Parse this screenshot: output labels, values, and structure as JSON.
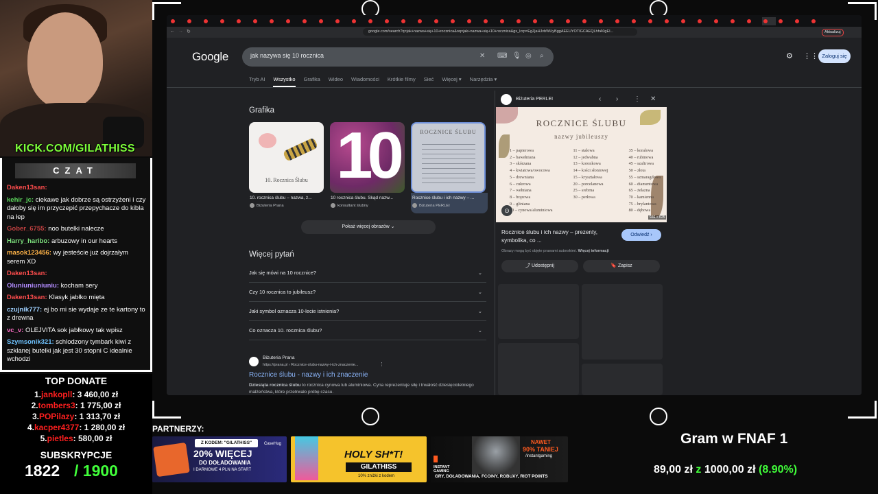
{
  "stream": {
    "channel": "KICK.COM/GILATHISS",
    "chat_header": "CZAT",
    "chat": [
      {
        "user": "Daken13san:",
        "text": "",
        "color": "#ff4d4d"
      },
      {
        "user": "kehir_jc:",
        "text": "ciekawe jak dobrze są ostrzyżeni i czy dałoby się im przyczepić przepychacze do kibla na łep",
        "color": "#5dd55d"
      },
      {
        "user": "Gober_6755:",
        "text": "noo butelki nalecze",
        "color": "#c04040"
      },
      {
        "user": "Harry_haribo:",
        "text": "arbuzowy in our hearts",
        "color": "#7de07d"
      },
      {
        "user": "masok123456:",
        "text": "wy jesteście już dojrzałym serem XD",
        "color": "#ffb347"
      },
      {
        "user": "Daken13san:",
        "text": "",
        "color": "#ff4d4d"
      },
      {
        "user": "Oluniuniuniuniu:",
        "text": "kocham sery",
        "color": "#b38cff"
      },
      {
        "user": "Daken13san:",
        "text": "Klasyk jabłko mięta",
        "color": "#ff4d4d"
      },
      {
        "user": "czujnik777:",
        "text": "ej bo mi sie wydaje ze te kartony to z drewna",
        "color": "#9fd0ff"
      },
      {
        "user": "vc_v:",
        "text": "OLEJVITA sok jabłkowy tak wpisz",
        "color": "#ff6ec7"
      },
      {
        "user": "Szymsonik321:",
        "text": "schlodzony tymbark kiwi z szklanej butelki jak jest 30 stopni C idealnie wchodzi",
        "color": "#6fc3ff"
      }
    ],
    "top_donate_title": "TOP DONATE",
    "donors": [
      {
        "rank": "1.",
        "name": "jankopll",
        "amount": ": 3 460,00 zł"
      },
      {
        "rank": "2.",
        "name": "tombers3",
        "amount": ": 1 775,00 zł"
      },
      {
        "rank": "3.",
        "name": "POPilazy",
        "amount": ": 1 313,70 zł"
      },
      {
        "rank": "4.",
        "name": "kacper4377",
        "amount": ": 1 280,00 zł"
      },
      {
        "rank": "5.",
        "name": "pietles",
        "amount": ": 580,00 zł"
      }
    ],
    "subs_title": "SUBSKRYPCJE",
    "subs_current": "1822",
    "subs_goal": "/ 1900",
    "partners_label": "PARTNERZY:",
    "banner1": {
      "code": "Z KODEM: \"GILATHISS\"",
      "big": "20% WIĘCEJ",
      "mid": "DO DOŁADOWANIA",
      "small": "I DARMOWE 4 PLN NA START",
      "brand": "CaseHug"
    },
    "banner2": {
      "big": "HOLY SH*T!",
      "mid": "GILATHISS",
      "small": "10% zniżki z kodem"
    },
    "banner3": {
      "tag": "NAWET",
      "big": "90% TANIEJ",
      "handle": "/instantgaming",
      "brand": "INSTANT GAMING",
      "small": "GRY, DOŁADOWANIA, FCOINY, ROBUXY, RIOT POINTS"
    },
    "game_title": "Gram w FNAF 1",
    "goal_current": "89,00 zł",
    "goal_sep": "z",
    "goal_total": "1000,00 zł",
    "goal_pct": "(8.90%)"
  },
  "browser": {
    "url": "google.com/search?q=jak+nazwa+się+10+rocznica&oq=jak+nazwa+się+10+rocznica&gs_lcrp=EgZjaHJvbWUyBggAEEUYOTIGCAEQLhhA0gEI...",
    "update_label": "Aktualizuj",
    "google_logo": "Google",
    "query": "jak nazywa się 10 rocznica",
    "signin": "Zaloguj się",
    "nav": [
      "Tryb AI",
      "Wszystko",
      "Grafika",
      "Wideo",
      "Wiadomości",
      "Krótkie filmy",
      "Sieć",
      "Więcej ▾",
      "Narzędzia ▾"
    ],
    "images_heading": "Grafika",
    "images": [
      {
        "caption": "10. rocznica ślubu – nazwa, ż...",
        "source": "Biżuteria Prana",
        "overlay": "10. Rocznica Ślubu"
      },
      {
        "caption": "10 rocznica ślubu. Skąd nazw...",
        "source": "konsultant ślubny",
        "overlay": "10"
      },
      {
        "caption": "Rocznice ślubu i ich nazwy – ...",
        "source": "Biżuteria PERLEI",
        "overlay": "ROCZNICE ŚLUBU"
      }
    ],
    "more_images": "Pokaż więcej obrazów ⌄",
    "paa_heading": "Więcej pytań",
    "questions": [
      "Jak się mówi na 10 rocznice?",
      "Czy 10 rocznica to jubileusz?",
      "Jaki symbol oznacza 10-lecie istnienia?",
      "Co oznacza 10. rocznica ślubu?"
    ],
    "result": {
      "source": "Biżuteria Prana",
      "url": "https://prana.pl › Rocznice-slubu-nazwy-i-ich-znaczenie...",
      "title": "Rocznice ślubu - nazwy i ich znaczenie",
      "snippet_bold": "Dziesiąta rocznica ślubu",
      "snippet": " to rocznica cynowa lub aluminiowa. Cyna reprezentuje siłę i trwałość dziesięcioletniego małżeństwa, które przetrwało próbę czasu."
    },
    "panel": {
      "source": "Biżuteria PERLEI",
      "img_title": "ROCZNICE ŚLUBU",
      "img_subtitle": "nazwy jubileuszy",
      "col1": [
        "1 – papierowa",
        "2 – bawełniana",
        "3 – skórzana",
        "4 – kwiatowa/owocowa",
        "5 – drewniana",
        "6 – cukrowa",
        "7 – wełniana",
        "8 – brązowa",
        "9 – gliniana",
        "10 – cynowa/aluminiowa"
      ],
      "col2": [
        "11 – stalowa",
        "12 – jedwabna",
        "13 – koronkowa",
        "14 – kości słoniowej",
        "15 – kryształowa",
        "20 – porcelanowa",
        "25 – srebrna",
        "30 – perłowa"
      ],
      "col3": [
        "35 – koralowa",
        "40 – rubinowa",
        "45 – szafirowa",
        "50 – złota",
        "55 – szmaragdowa",
        "60 – diamentowa",
        "65 – żelazna",
        "70 – kamienna",
        "75 – brylantowa",
        "80 – dębowa"
      ],
      "dims": "936 × 625",
      "title": "Rocznice ślubu i ich nazwy – prezenty, symbolika, co ...",
      "visit": "Odwiedź ›",
      "copyright": "Obrazy mogą być objęte prawami autorskimi.",
      "more_info": "Więcej informacji",
      "share": "Udostępnij",
      "save": "Zapisz"
    }
  }
}
